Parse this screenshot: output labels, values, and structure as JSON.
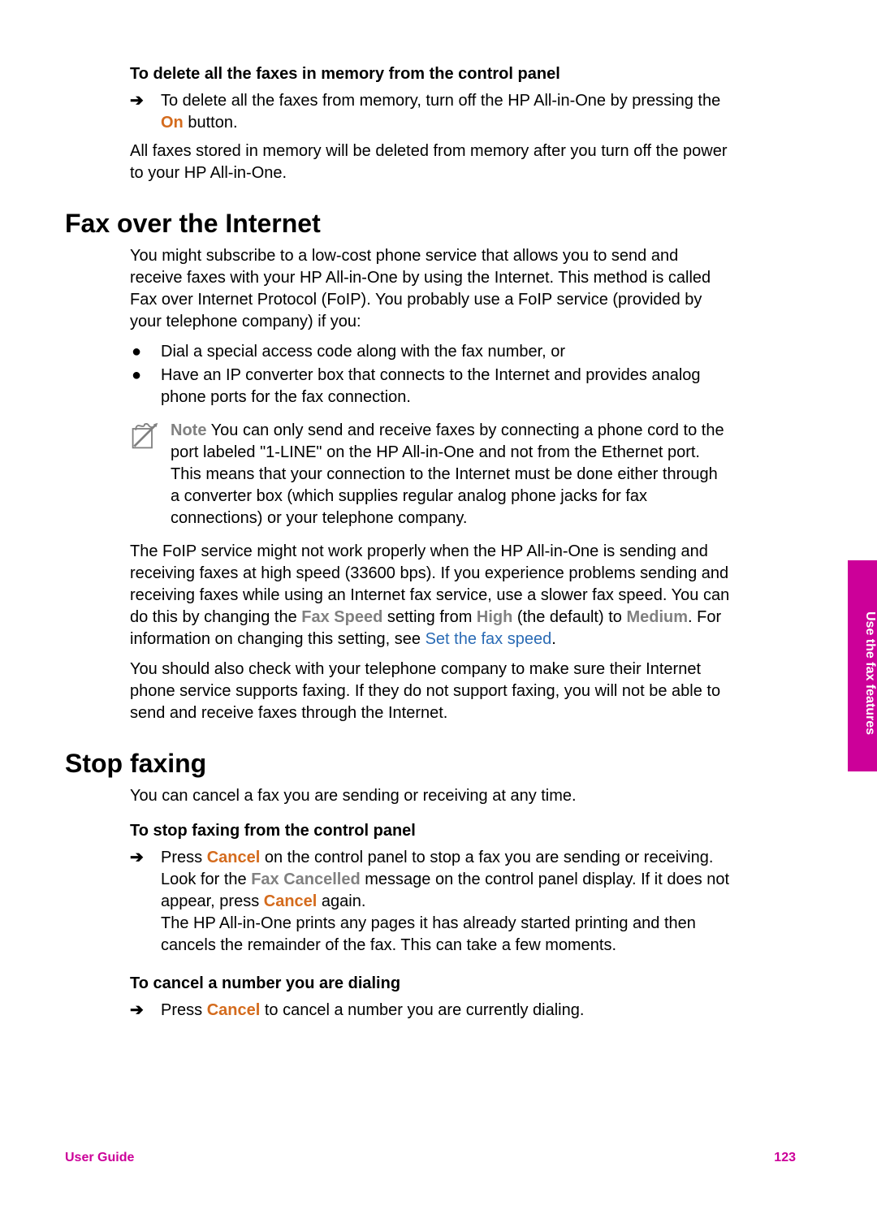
{
  "section1": {
    "heading": "To delete all the faxes in memory from the control panel",
    "item_before_on": "To delete all the faxes from memory, turn off the HP All-in-One by pressing the ",
    "on_label": "On",
    "item_after_on": " button.",
    "post": "All faxes stored in memory will be deleted from memory after you turn off the power to your HP All-in-One."
  },
  "foip": {
    "heading": "Fax over the Internet",
    "intro": "You might subscribe to a low-cost phone service that allows you to send and receive faxes with your HP All-in-One by using the Internet. This method is called Fax over Internet Protocol (FoIP). You probably use a FoIP service (provided by your telephone company) if you:",
    "bullets": [
      "Dial a special access code along with the fax number, or",
      "Have an IP converter box that connects to the Internet and provides analog phone ports for the fax connection."
    ],
    "note_label": "Note",
    "note_text": " You can only send and receive faxes by connecting a phone cord to the port labeled \"1-LINE\" on the HP All-in-One and not from the Ethernet port. This means that your connection to the Internet must be done either through a converter box (which supplies regular analog phone jacks for fax connections) or your telephone company.",
    "p2_a": "The FoIP service might not work properly when the HP All-in-One is sending and receiving faxes at high speed (33600 bps). If you experience problems sending and receiving faxes while using an Internet fax service, use a slower fax speed. You can do this by changing the ",
    "fax_speed": "Fax Speed",
    "p2_b": " setting from ",
    "high": "High",
    "p2_c": " (the default) to ",
    "medium": "Medium",
    "p2_d": ". For information on changing this setting, see ",
    "link": "Set the fax speed",
    "p2_e": ".",
    "p3": "You should also check with your telephone company to make sure their Internet phone service supports faxing. If they do not support faxing, you will not be able to send and receive faxes through the Internet."
  },
  "stop": {
    "heading": "Stop faxing",
    "intro": "You can cancel a fax you are sending or receiving at any time.",
    "sub1_heading": "To stop faxing from the control panel",
    "s1_a": "Press ",
    "cancel1": "Cancel",
    "s1_b": " on the control panel to stop a fax you are sending or receiving. Look for the ",
    "fax_cancelled": "Fax Cancelled",
    "s1_c": " message on the control panel display. If it does not appear, press ",
    "cancel2": "Cancel",
    "s1_d": " again.",
    "s1_e": "The HP All-in-One prints any pages it has already started printing and then cancels the remainder of the fax. This can take a few moments.",
    "sub2_heading": "To cancel a number you are dialing",
    "s2_a": "Press ",
    "cancel3": "Cancel",
    "s2_b": " to cancel a number you are currently dialing."
  },
  "side_tab": "Use the fax features",
  "footer_left": "User Guide",
  "footer_right": "123"
}
